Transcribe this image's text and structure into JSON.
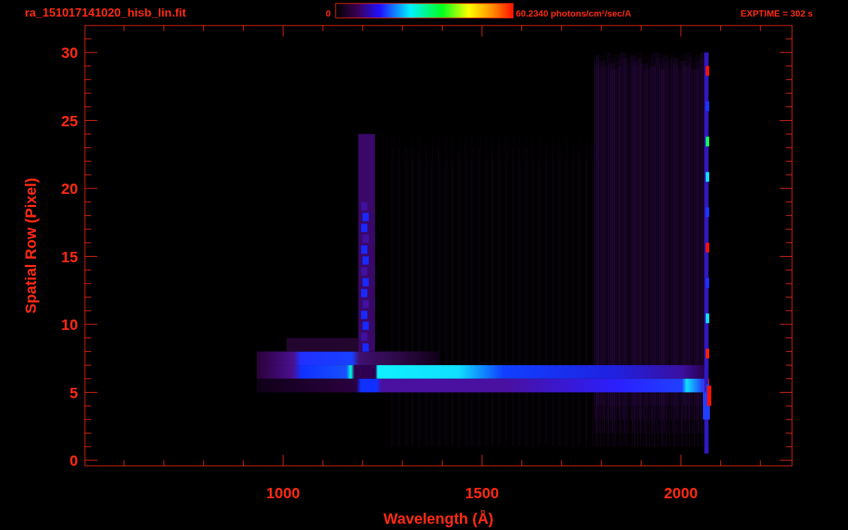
{
  "header": {
    "file_name": "ra_151017141020_hisb_lin.fit",
    "exposure": "EXPTIME = 302 s"
  },
  "colorbar": {
    "min_label": "0",
    "max_label": "60.2340 photons/cm$^{2}$/sec/A"
  },
  "y_axis": {
    "title": "Spatial Row (Pixel)",
    "tick_labels": [
      "30",
      "25",
      "20",
      "15",
      "10",
      "5",
      "0"
    ]
  },
  "x_axis": {
    "title": "Wavelength (Å)",
    "tick_labels": [
      "1000",
      "1500",
      "2000"
    ]
  }
}
